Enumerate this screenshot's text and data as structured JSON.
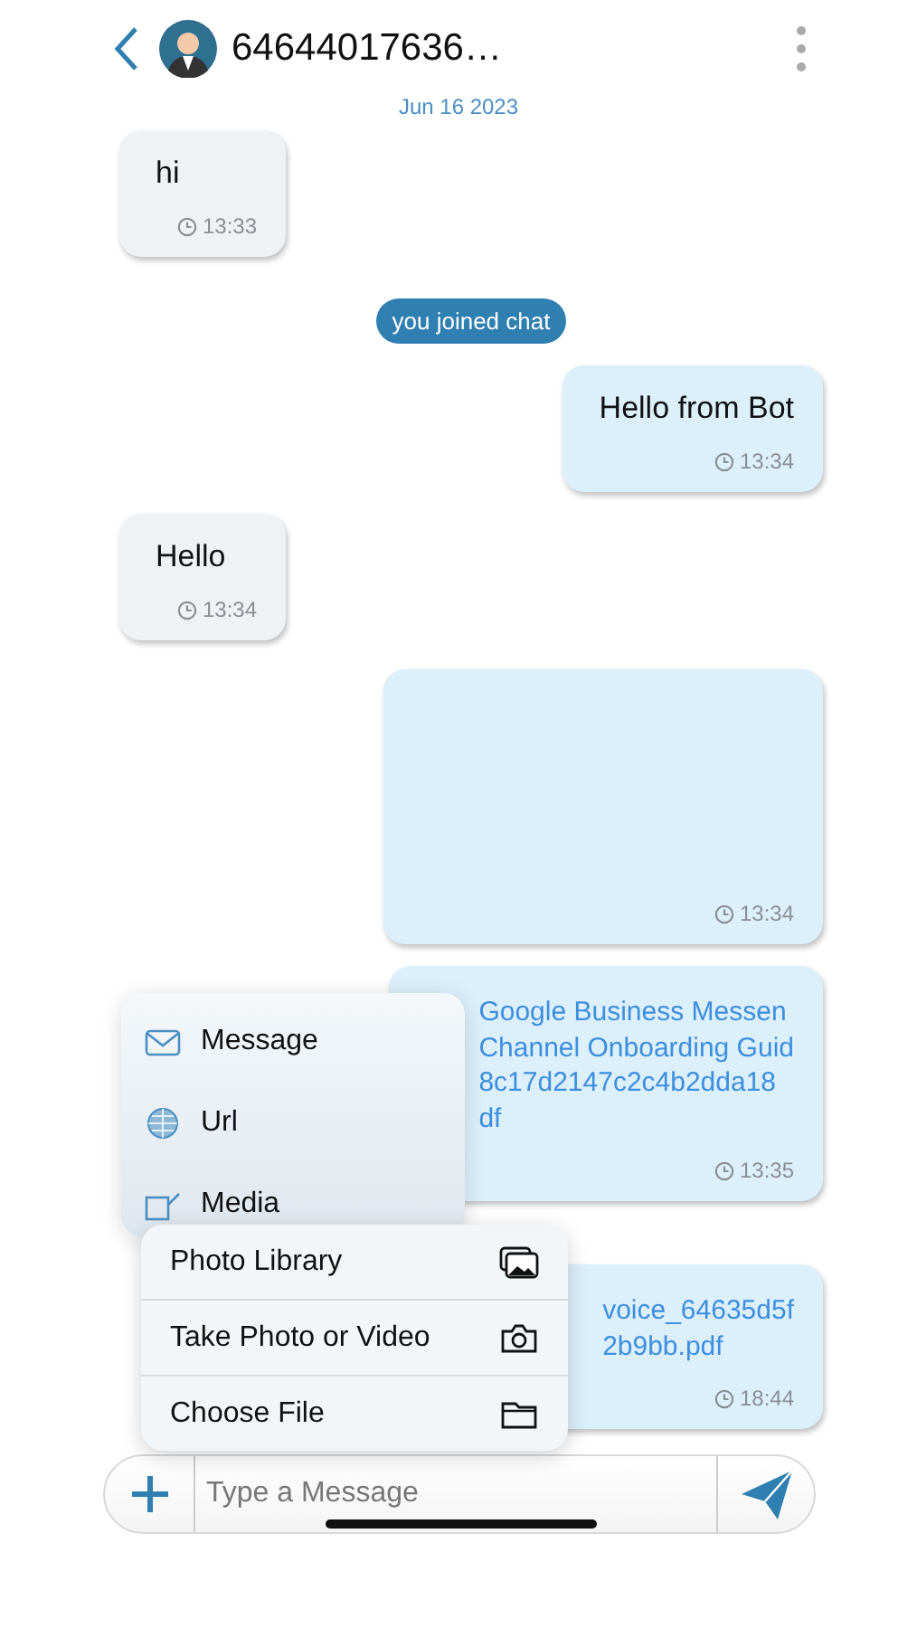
{
  "header": {
    "title": "64644017636…"
  },
  "date": "Jun 16 2023",
  "messages": [
    {
      "kind": "text",
      "outgoing": false,
      "text": "hi",
      "time": "13:33"
    },
    {
      "kind": "system",
      "text": "you joined chat"
    },
    {
      "kind": "text",
      "outgoing": true,
      "text": "Hello from Bot",
      "time": "13:34"
    },
    {
      "kind": "text",
      "outgoing": false,
      "text": "Hello",
      "time": "13:34"
    },
    {
      "kind": "blank",
      "outgoing": true,
      "time": "13:34"
    },
    {
      "kind": "file",
      "outgoing": true,
      "text": "Google Business Messen\nChannel Onboarding Guid\n8c17d2147c2c4b2dda18\ndf",
      "time": "13:35"
    },
    {
      "kind": "file",
      "outgoing": true,
      "text": "voice_64635d5f\n2b9bb.pdf",
      "time": "18:44"
    }
  ],
  "attach_menu": [
    {
      "kind": "message",
      "label": "Message"
    },
    {
      "kind": "url",
      "label": "Url"
    },
    {
      "kind": "media",
      "label": "Media"
    }
  ],
  "media_menu": [
    {
      "kind": "library",
      "label": "Photo Library"
    },
    {
      "kind": "camera",
      "label": "Take Photo or Video"
    },
    {
      "kind": "file",
      "label": "Choose File"
    }
  ],
  "composer": {
    "placeholder": "Type a Message"
  }
}
